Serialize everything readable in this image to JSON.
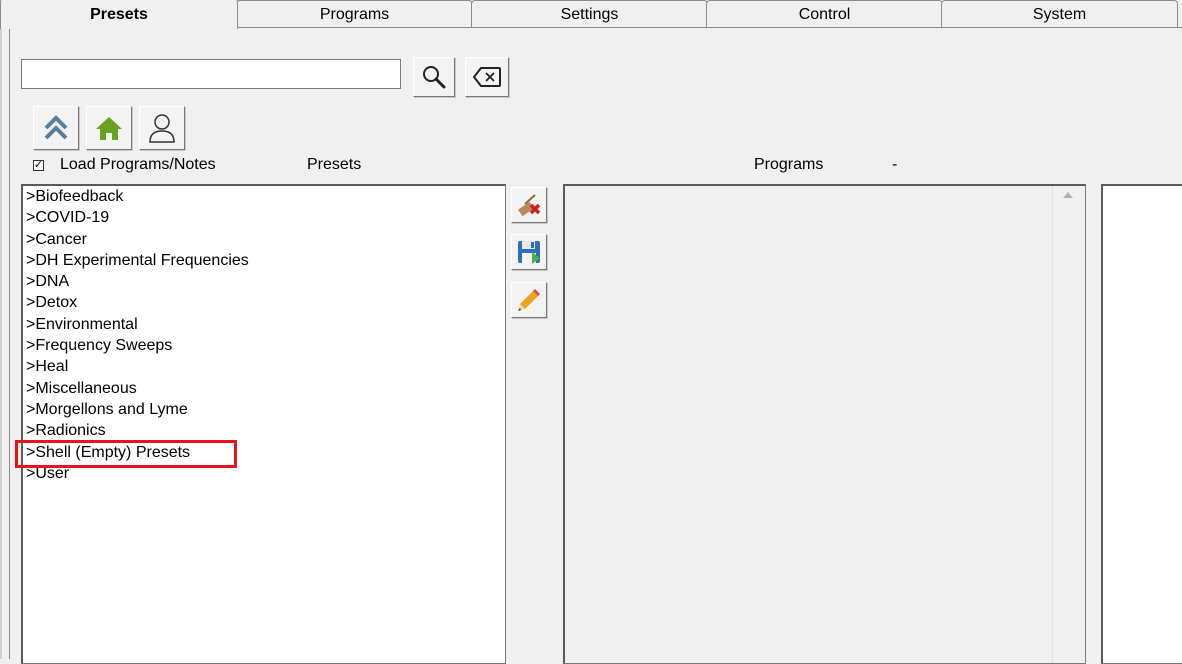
{
  "tabs": [
    {
      "label": "Presets",
      "active": true
    },
    {
      "label": "Programs",
      "active": false
    },
    {
      "label": "Settings",
      "active": false
    },
    {
      "label": "Control",
      "active": false
    },
    {
      "label": "System",
      "active": false
    }
  ],
  "search": {
    "value": "",
    "placeholder": ""
  },
  "toolbar": {
    "search_icon": "magnifier-icon",
    "clear_icon": "backspace-clear-icon",
    "up_icon": "double-chevron-up-icon",
    "home_icon": "home-icon",
    "user_icon": "user-icon"
  },
  "load_programs": {
    "label": "Load Programs/Notes",
    "checked": true,
    "check_glyph": "✓"
  },
  "headers": {
    "presets": "Presets",
    "programs": "Programs",
    "programs_suffix": "-"
  },
  "presets_list": [
    ">Biofeedback",
    ">COVID-19",
    ">Cancer",
    ">DH Experimental Frequencies",
    ">DNA",
    ">Detox",
    ">Environmental",
    ">Frequency Sweeps",
    ">Heal",
    ">Miscellaneous",
    ">Morgellons and Lyme",
    ">Radionics",
    ">Shell (Empty) Presets",
    ">User"
  ],
  "highlighted_item": ">Shell (Empty) Presets",
  "side_buttons": [
    "broom-delete-icon",
    "save-disk-icon",
    "pencil-edit-icon"
  ],
  "colors": {
    "highlight": "#e8141b",
    "home_green": "#6aa121",
    "up_blue": "#4a6f8a"
  }
}
